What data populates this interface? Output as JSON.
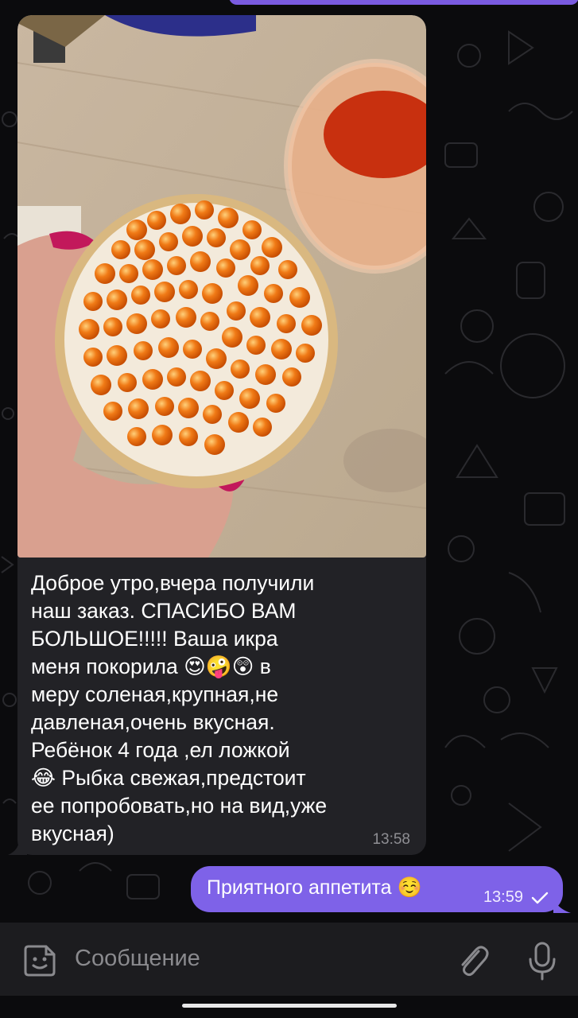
{
  "incoming": {
    "text": "Доброе утро,вчера получили\nнаш заказ. СПАСИБО ВАМ\nБОЛЬШОЕ!!!!! Ваша икра\nменя покорила 😍🤪😲 в\nмеру соленая,крупная,не\nдавленая,очень вкусная.\nРебёнок 4 года ,ел ложкой\n😂 Рыбка свежая,предстоит\nее попробовать,но на вид,уже\nвкусная)",
    "time": "13:58"
  },
  "outgoing": {
    "text": "Приятного аппетита ☺️",
    "time": "13:59",
    "status_icon": "check-icon"
  },
  "composer": {
    "placeholder": "Сообщение",
    "left_icon": "sticker-icon",
    "attach_icon": "paperclip-icon",
    "mic_icon": "microphone-icon"
  },
  "colors": {
    "background": "#0b0b0d",
    "incoming_bubble": "#222226",
    "outgoing_bubble": "#7e62e8",
    "input_bar": "#1c1c1f"
  }
}
